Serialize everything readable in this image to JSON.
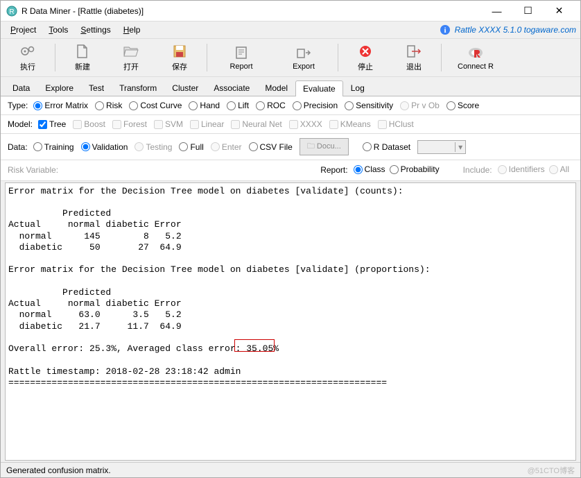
{
  "titlebar": {
    "title": "R Data Miner - [Rattle (diabetes)]"
  },
  "menubar": {
    "items": [
      "Project",
      "Tools",
      "Settings",
      "Help"
    ],
    "brand_prefix": "Rattle XXXX 5.1.0 ",
    "brand_link": "togaware.com"
  },
  "toolbar": {
    "execute": "执行",
    "new": "新建",
    "open": "打开",
    "save": "保存",
    "report": "Report",
    "export": "Export",
    "stop": "停止",
    "quit": "退出",
    "connectr": "Connect R"
  },
  "tabs": [
    "Data",
    "Explore",
    "Test",
    "Transform",
    "Cluster",
    "Associate",
    "Model",
    "Evaluate",
    "Log"
  ],
  "active_tab": "Evaluate",
  "type_row": {
    "label": "Type:",
    "options": [
      "Error Matrix",
      "Risk",
      "Cost Curve",
      "Hand",
      "Lift",
      "ROC",
      "Precision",
      "Sensitivity",
      "Pr v Ob",
      "Score"
    ],
    "selected": "Error Matrix",
    "disabled": [
      "Pr v Ob"
    ]
  },
  "model_row": {
    "label": "Model:",
    "options": [
      "Tree",
      "Boost",
      "Forest",
      "SVM",
      "Linear",
      "Neural Net",
      "XXXX",
      "KMeans",
      "HClust"
    ],
    "checked": [
      "Tree"
    ],
    "disabled": [
      "Boost",
      "Forest",
      "SVM",
      "Linear",
      "Neural Net",
      "XXXX",
      "KMeans",
      "HClust"
    ]
  },
  "data_row": {
    "label": "Data:",
    "options": [
      "Training",
      "Validation",
      "Testing",
      "Full",
      "Enter",
      "CSV File"
    ],
    "selected": "Validation",
    "disabled": [
      "Testing",
      "Enter"
    ],
    "file_button": "Docu...",
    "rdataset": "R Dataset"
  },
  "risk_row": {
    "risk_label": "Risk Variable:",
    "report_label": "Report:",
    "report_options": [
      "Class",
      "Probability"
    ],
    "report_selected": "Class",
    "include_label": "Include:",
    "include_options": [
      "Identifiers",
      "All"
    ],
    "include_disabled": true
  },
  "output_lines": [
    "Error matrix for the Decision Tree model on diabetes [validate] (counts):",
    "",
    "          Predicted",
    "Actual     normal diabetic Error",
    "  normal      145        8   5.2",
    "  diabetic     50       27  64.9",
    "",
    "Error matrix for the Decision Tree model on diabetes [validate] (proportions):",
    "",
    "          Predicted",
    "Actual     normal diabetic Error",
    "  normal     63.0      3.5   5.2",
    "  diabetic   21.7     11.7  64.9",
    "",
    "Overall error: 25.3%, Averaged class error: 35.05%",
    "",
    "Rattle timestamp: 2018-02-28 23:18:42 admin",
    "======================================================================"
  ],
  "statusbar": {
    "text": "Generated confusion matrix.",
    "watermark": "@51CTO博客"
  }
}
